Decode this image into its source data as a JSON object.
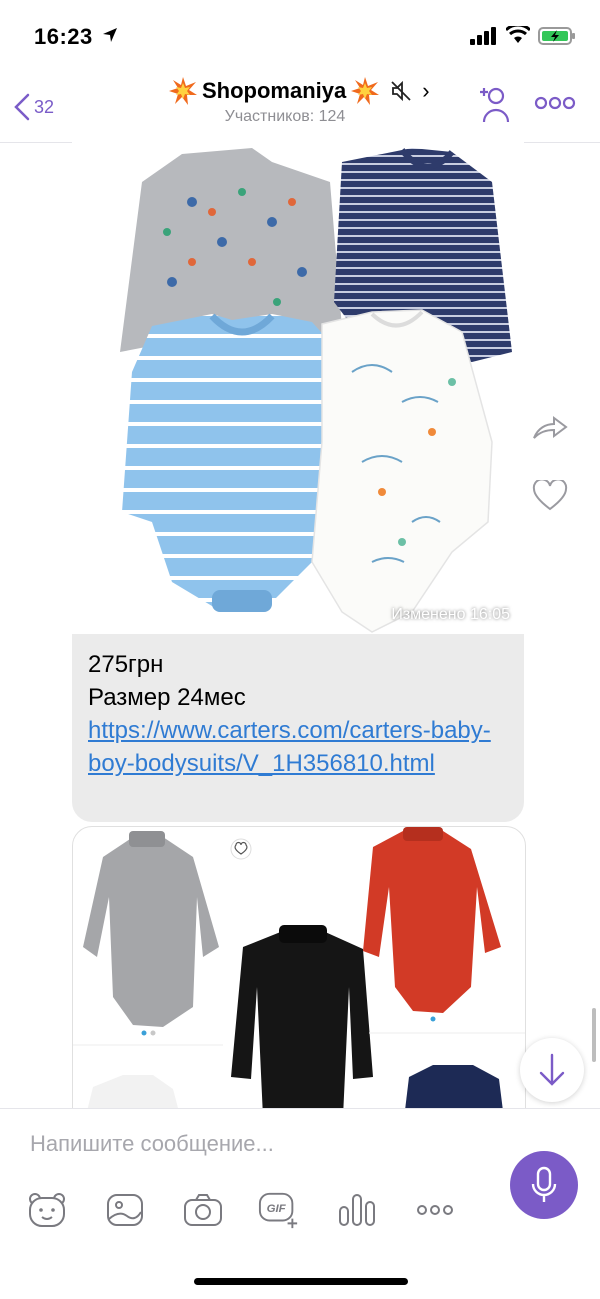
{
  "status_bar": {
    "time": "16:23"
  },
  "header": {
    "back_count": "32",
    "title": "Shopomaniya",
    "subtitle": "Участников: 124",
    "chevron": "›"
  },
  "messages": [
    {
      "edited_label": "Изменено  16:05",
      "price": "275грн",
      "size": "Размер 24мес",
      "link": "https://www.carters.com/carters-baby-boy-bodysuits/V_1H356810.html"
    }
  ],
  "composer": {
    "placeholder": "Напишите сообщение...",
    "tools": [
      "sticker-icon",
      "gallery-icon",
      "camera-icon",
      "gif-icon",
      "poll-icon",
      "more-icon"
    ]
  },
  "colors": {
    "accent": "#7b5bc7",
    "link": "#2f7bd3",
    "bubble": "#ebebeb"
  }
}
